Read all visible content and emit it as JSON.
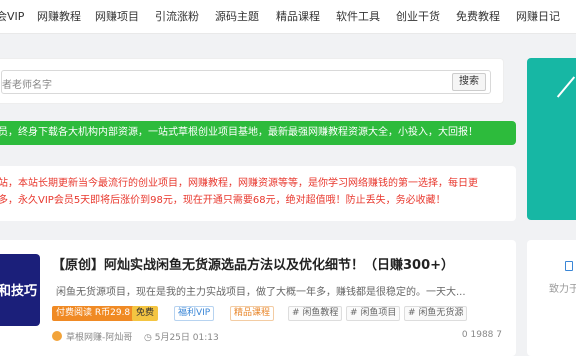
{
  "nav": {
    "items": [
      "会VIP",
      "网赚教程",
      "网赚项目",
      "引流涨粉",
      "源码主题",
      "精品课程",
      "软件工具",
      "创业干货",
      "免费教程",
      "网赚日记"
    ]
  },
  "search": {
    "placeholder": "者老师名字",
    "button": "搜索"
  },
  "banner": {
    "text": "员，终身下载各大机构内部资源，一站式草根创业项目基地，最新最强网赚教程资源大全，小投入，大回报！"
  },
  "notice": {
    "line1": "站，本站长期更新当今最流行的创业项目，网赚教程，网赚资源等等，是你学习网络赚钱的第一选择，每日更",
    "line2": "多，永久VIP会员5天即将后涨价到98元，现在开通只需要68元，绝对超值哦！防止丢失，务必收藏！"
  },
  "post": {
    "thumb_text": "和技巧",
    "title": "【原创】阿灿实战闲鱼无货源选品方法以及优化细节！（日赚300+）",
    "excerpt": "闲鱼无货源项目，现在是我的主力实战项目，做了大概一年多，赚钱都是很稳定的。一天大...",
    "tags": {
      "price": "付费阅读 R币29.8",
      "free": "免费",
      "vip": "福利VIP",
      "course": "精品课程",
      "t1": "# 闲鱼教程",
      "t2": "# 闲鱼项目",
      "t3": "# 闲鱼无货源"
    },
    "author": "草根网赚-阿灿哥",
    "date": "5月25日 01:13",
    "stats": "0  1988  7"
  },
  "side": {
    "text": "致力于"
  },
  "colors": {
    "accent_green": "#2dbb3c",
    "notice_red": "#e8382e",
    "teal": "#17b7a4",
    "thumb_blue": "#1b1f7a"
  }
}
